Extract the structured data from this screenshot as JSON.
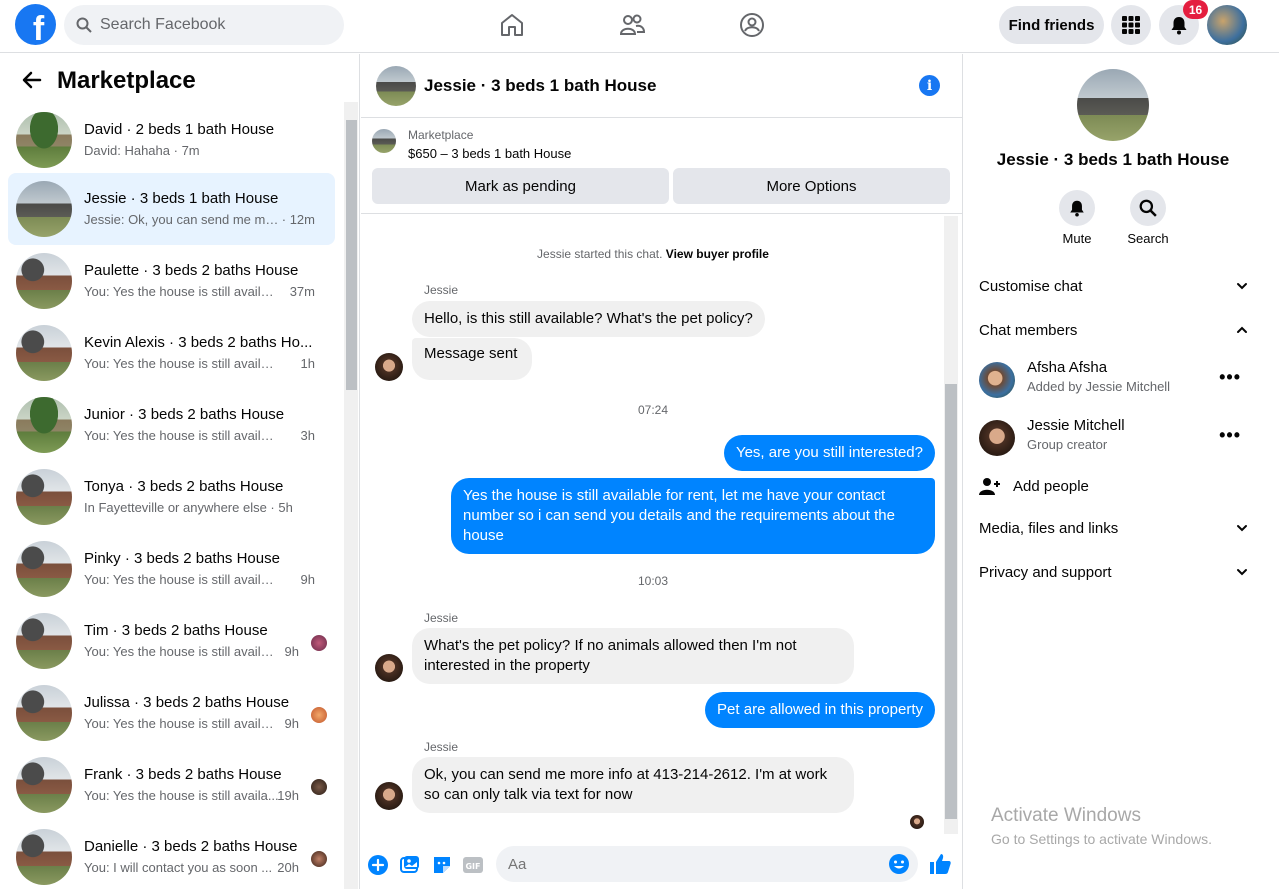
{
  "topbar": {
    "search_placeholder": "Search Facebook",
    "find_friends_label": "Find friends",
    "notification_count": "16",
    "brand_color": "#1877f2"
  },
  "left": {
    "title": "Marketplace",
    "conversations": [
      {
        "name": "David · 2 beds 1 bath House",
        "preview": "David: Hahaha",
        "time": "7m"
      },
      {
        "name": "Jessie · 3 beds 1 bath House",
        "preview": "Jessie: Ok, you can send me mor...",
        "time": "12m"
      },
      {
        "name": "Paulette · 3 beds 2 baths House",
        "preview": "You: Yes the house is still availabl...",
        "time": "37m"
      },
      {
        "name": "Kevin Alexis · 3 beds 2 baths Ho...",
        "preview": "You: Yes the house is still available ...",
        "time": "1h"
      },
      {
        "name": "Junior · 3 beds 2 baths House",
        "preview": "You: Yes the house is still available ...",
        "time": "3h"
      },
      {
        "name": "Tonya · 3 beds 2 baths House",
        "preview": "In Fayetteville or anywhere else",
        "time": "5h"
      },
      {
        "name": "Pinky · 3 beds 2 baths House",
        "preview": "You: Yes the house is still available ...",
        "time": "9h"
      },
      {
        "name": "Tim · 3 beds 2 baths House",
        "preview": "You: Yes the house is still availab...",
        "time": "9h"
      },
      {
        "name": "Julissa · 3 beds 2 baths House",
        "preview": "You: Yes the house is still availab...",
        "time": "9h"
      },
      {
        "name": "Frank · 3 beds 2 baths House",
        "preview": "You: Yes the house is still availa...",
        "time": "19h"
      },
      {
        "name": "Danielle · 3 beds 2 baths House",
        "preview": "You: I will contact you as soon ...",
        "time": "20h"
      }
    ]
  },
  "chat": {
    "title": "Jessie · 3 beds 1 bath House",
    "marketplace_label": "Marketplace",
    "listing_price": "$650 – 3 beds 1 bath House",
    "mark_pending_label": "Mark as pending",
    "more_options_label": "More Options",
    "started_text": "Jessie started this chat.",
    "buyer_profile_link": "View buyer profile",
    "sender_name": "Jessie",
    "messages": {
      "m1": "Hello, is this still available? What's the pet policy?",
      "m2": "Message sent",
      "t1": "07:24",
      "m3": "Yes, are you still interested?",
      "m4": "Yes the house is still available for rent, let me have your contact number so i can send you details and the requirements about the house",
      "t2": "10:03",
      "m5": "What's the pet policy? If no animals allowed then I'm not interested in the property",
      "m6": "Pet are allowed in this property",
      "m7": "Ok, you can send me more info at 413-214-2612. I'm at work so can only talk via text for now"
    },
    "composer_placeholder": "Aa",
    "outgoing_color": "#0084ff"
  },
  "right": {
    "title": "Jessie · 3 beds 1 bath House",
    "mute_label": "Mute",
    "search_label": "Search",
    "customise_chat": "Customise chat",
    "chat_members": "Chat members",
    "members": [
      {
        "name": "Afsha Afsha",
        "sub": "Added by Jessie Mitchell"
      },
      {
        "name": "Jessie Mitchell",
        "sub": "Group creator"
      }
    ],
    "add_people": "Add people",
    "media_files_links": "Media, files and links",
    "privacy_support": "Privacy and support"
  },
  "watermark": {
    "line1": "Activate Windows",
    "line2": "Go to Settings to activate Windows."
  }
}
